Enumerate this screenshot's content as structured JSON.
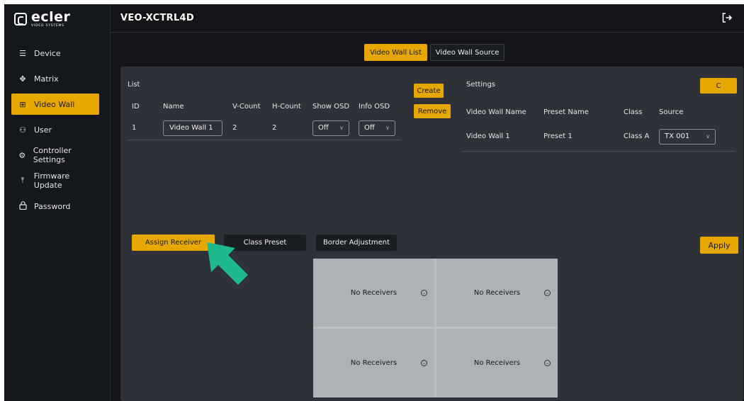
{
  "brand": {
    "word": "ecler",
    "sub": "VIDEO SYSTEMS"
  },
  "header": {
    "title": "VEO-XCTRL4D",
    "logout_icon": "logout-icon"
  },
  "sidebar": {
    "items": [
      {
        "label": "Device",
        "icon": "device-icon",
        "glyph": "☰",
        "active": false
      },
      {
        "label": "Matrix",
        "icon": "matrix-icon",
        "glyph": "✥",
        "active": false
      },
      {
        "label": "Video Wall",
        "icon": "grid-icon",
        "glyph": "⊞",
        "active": true
      },
      {
        "label": "User",
        "icon": "user-icon",
        "glyph": "⚇",
        "active": false
      },
      {
        "label": "Controller Settings",
        "icon": "gear-icon",
        "glyph": "⚙",
        "active": false
      },
      {
        "label": "Firmware Update",
        "icon": "upload-icon",
        "glyph": "⤒",
        "active": false
      },
      {
        "label": "Password",
        "icon": "lock-icon",
        "glyph": "🔒",
        "active": false
      }
    ]
  },
  "tabs": [
    {
      "label": "Video Wall List",
      "active": true
    },
    {
      "label": "Video Wall Source",
      "active": false
    }
  ],
  "list": {
    "title": "List",
    "headers": [
      "ID",
      "Name",
      "V-Count",
      "H-Count",
      "Show OSD",
      "Info OSD"
    ],
    "rows": [
      {
        "id": "1",
        "name": "Video Wall 1",
        "v_count": "2",
        "h_count": "2",
        "show_osd": "Off",
        "info_osd": "Off"
      }
    ],
    "create_label": "Create",
    "remove_label": "Remove"
  },
  "settings": {
    "title": "Settings",
    "refresh_label": "C",
    "headers": [
      "Video Wall Name",
      "Preset Name",
      "Class",
      "Source"
    ],
    "rows": [
      {
        "video_wall_name": "Video Wall 1",
        "preset_name": "Preset 1",
        "class": "Class A",
        "source": "TX 001"
      }
    ]
  },
  "actions": {
    "assign_receiver": "Assign Receiver",
    "class_preset": "Class Preset",
    "border_adjustment": "Border Adjustment",
    "apply": "Apply"
  },
  "wall": {
    "cells": [
      "No Receivers",
      "No Receivers",
      "No Receivers",
      "No Receivers"
    ]
  },
  "colors": {
    "accent": "#e6a800",
    "sidebar": "#14171b",
    "panel": "#2e3238",
    "arrow": "#1fb98e"
  }
}
